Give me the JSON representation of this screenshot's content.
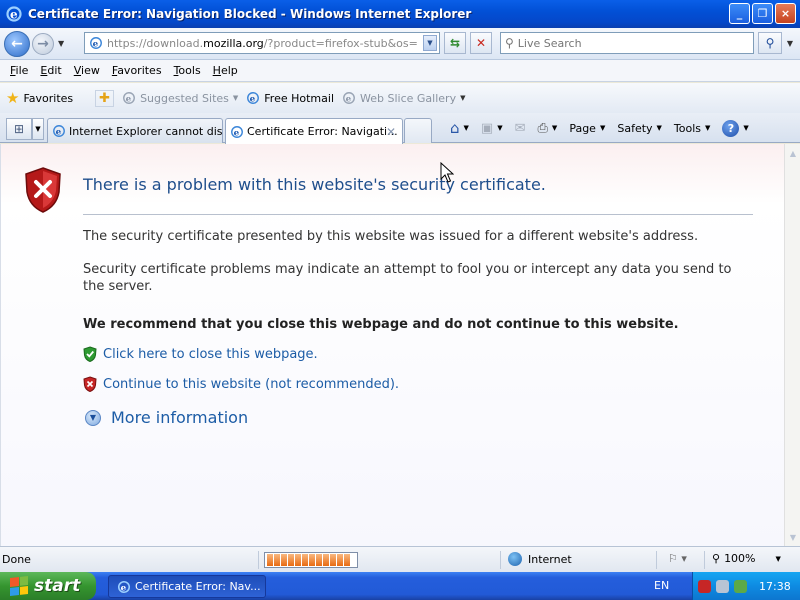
{
  "window": {
    "title": "Certificate Error: Navigation Blocked - Windows Internet Explorer",
    "buttons": [
      "_",
      "❐",
      "×"
    ]
  },
  "address_bar": {
    "url_prefix": "https://download.",
    "url_domain": "mozilla.org",
    "url_suffix": "/?product=firefox-stub&os=win&lan",
    "search_placeholder": "Live Search"
  },
  "menu": [
    "File",
    "Edit",
    "View",
    "Favorites",
    "Tools",
    "Help"
  ],
  "favorites_bar": {
    "favorites_label": "Favorites",
    "items": [
      "Suggested Sites",
      "Free Hotmail",
      "Web Slice Gallery"
    ]
  },
  "tabs": [
    {
      "label": "Internet Explorer cannot dis...",
      "active": false
    },
    {
      "label": "Certificate Error: Navigati...",
      "active": true
    }
  ],
  "command_bar": [
    "Page",
    "Safety",
    "Tools"
  ],
  "page": {
    "heading": "There is a problem with this website's security certificate.",
    "p1": "The security certificate presented by this website was issued for a different website's address.",
    "p2": "Security certificate problems may indicate an attempt to fool you or intercept any data you send to the server.",
    "p3": "We recommend that you close this webpage and do not continue to this website.",
    "close_link": "Click here to close this webpage.",
    "continue_link": "Continue to this website (not recommended).",
    "more_info": "More information"
  },
  "status_bar": {
    "status": "Done",
    "zone": "Internet",
    "zoom": "100%"
  },
  "taskbar": {
    "start": "start",
    "task": "Certificate Error: Nav...",
    "language": "EN",
    "clock": "17:38"
  },
  "colors": {
    "title_bar": "#0250D6",
    "heading": "#1F4E8C",
    "link": "#1C5CA6",
    "start_button": "#35952F"
  }
}
